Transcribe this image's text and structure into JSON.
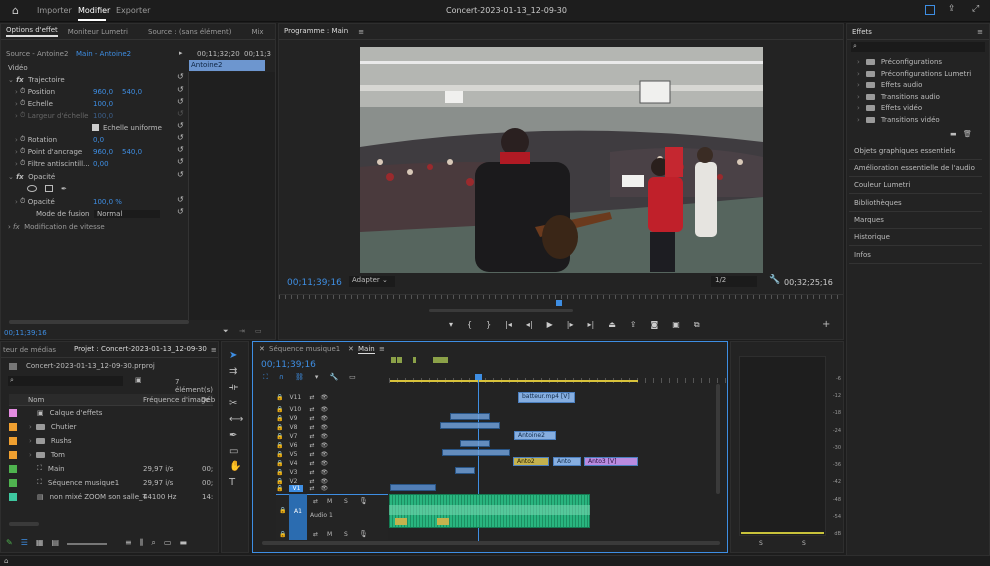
{
  "topbar": {
    "home": "home-icon",
    "tabs": [
      "Importer",
      "Modifier",
      "Exporter"
    ],
    "active": 1,
    "title": "Concert-2023-01-13_12-09-30"
  },
  "effect_options": {
    "tabs": [
      "Options d'effet",
      "Moniteur Lumetri",
      "Source : (sans élément)",
      "Mix"
    ],
    "source": "Source - Antoine2",
    "main": "Main - Antoine2",
    "tc1": "00;11;32;20",
    "tc2": "00;11;3",
    "clip": "Antoine2",
    "video": "Vidéo",
    "fx_traj": "Trajectoire",
    "position": {
      "label": "Position",
      "x": "960,0",
      "y": "540,0"
    },
    "echelle": {
      "label": "Echelle",
      "v": "100,0"
    },
    "largeur": {
      "label": "Largeur d'échelle",
      "v": "100,0"
    },
    "uniforme": "Echelle uniforme",
    "rotation": {
      "label": "Rotation",
      "v": "0,0"
    },
    "ancrage": {
      "label": "Point d'ancrage",
      "x": "960,0",
      "y": "540,0"
    },
    "filtre": {
      "label": "Filtre antiscintill...",
      "v": "0,00"
    },
    "opacite_fx": "Opacité",
    "opacite": {
      "label": "Opacité",
      "v": "100,0 %"
    },
    "fusion": {
      "label": "Mode de fusion",
      "v": "Normal"
    },
    "vitesse": "Modification de vitesse",
    "tc_bottom": "00;11;39;16"
  },
  "program": {
    "title": "Programme : Main",
    "tc": "00;11;39;16",
    "fit": "Adapter",
    "res": "1/2",
    "duration": "00;32;25;16"
  },
  "effects": {
    "title": "Effets",
    "items": [
      "Préconfigurations",
      "Préconfigurations Lumetri",
      "Effets audio",
      "Transitions audio",
      "Effets vidéo",
      "Transitions vidéo"
    ],
    "sections": [
      "Objets graphiques essentiels",
      "Amélioration essentielle de l'audio",
      "Couleur Lumetri",
      "Bibliothèques",
      "Marques",
      "Historique",
      "Infos"
    ]
  },
  "project": {
    "tabs": [
      "teur de médias",
      "Projet : Concert-2023-01-13_12-09-30"
    ],
    "file": "Concert-2023-01-13_12-09-30.prproj",
    "count": "7 élément(s)",
    "cols": [
      "Nom",
      "Fréquence d'image",
      "Déb"
    ],
    "rows": [
      {
        "name": "Calque d'effets",
        "fps": "",
        "deb": "",
        "color": "#e38ce0"
      },
      {
        "name": "Chutier",
        "fps": "",
        "deb": "",
        "color": "#f0a030"
      },
      {
        "name": "Rushs",
        "fps": "",
        "deb": "",
        "color": "#f0a030"
      },
      {
        "name": "Tom",
        "fps": "",
        "deb": "",
        "color": "#f0a030"
      },
      {
        "name": "Main",
        "fps": "29,97 i/s",
        "deb": "00;",
        "color": "#4fb34f"
      },
      {
        "name": "Séquence musique1",
        "fps": "29,97 i/s",
        "deb": "00;",
        "color": "#4fb34f"
      },
      {
        "name": "non mixé ZOOM son salle_T",
        "fps": "44100  Hz",
        "deb": "14:",
        "color": "#3ec8a0"
      }
    ]
  },
  "timeline": {
    "tabs": [
      "Séquence musique1",
      "Main"
    ],
    "tc": "00;11;39;16",
    "tracks": [
      "V11",
      "V10",
      "V9",
      "V8",
      "V7",
      "V6",
      "V5",
      "V4",
      "V3",
      "V2",
      "V1",
      "A1"
    ],
    "audio_name": "Audio 1",
    "clips": {
      "batteur": "batteur.mp4 [V]",
      "antoine2": "Antoine2",
      "anto2": "Anto2",
      "anto": "Anto",
      "anto3": "Anto3 [V]"
    }
  },
  "meter": {
    "ticks": [
      "-6",
      "-12",
      "-18",
      "-24",
      "-30",
      "-36",
      "-42",
      "-48",
      "-54",
      "dB"
    ],
    "solo": [
      "S",
      "S"
    ]
  }
}
